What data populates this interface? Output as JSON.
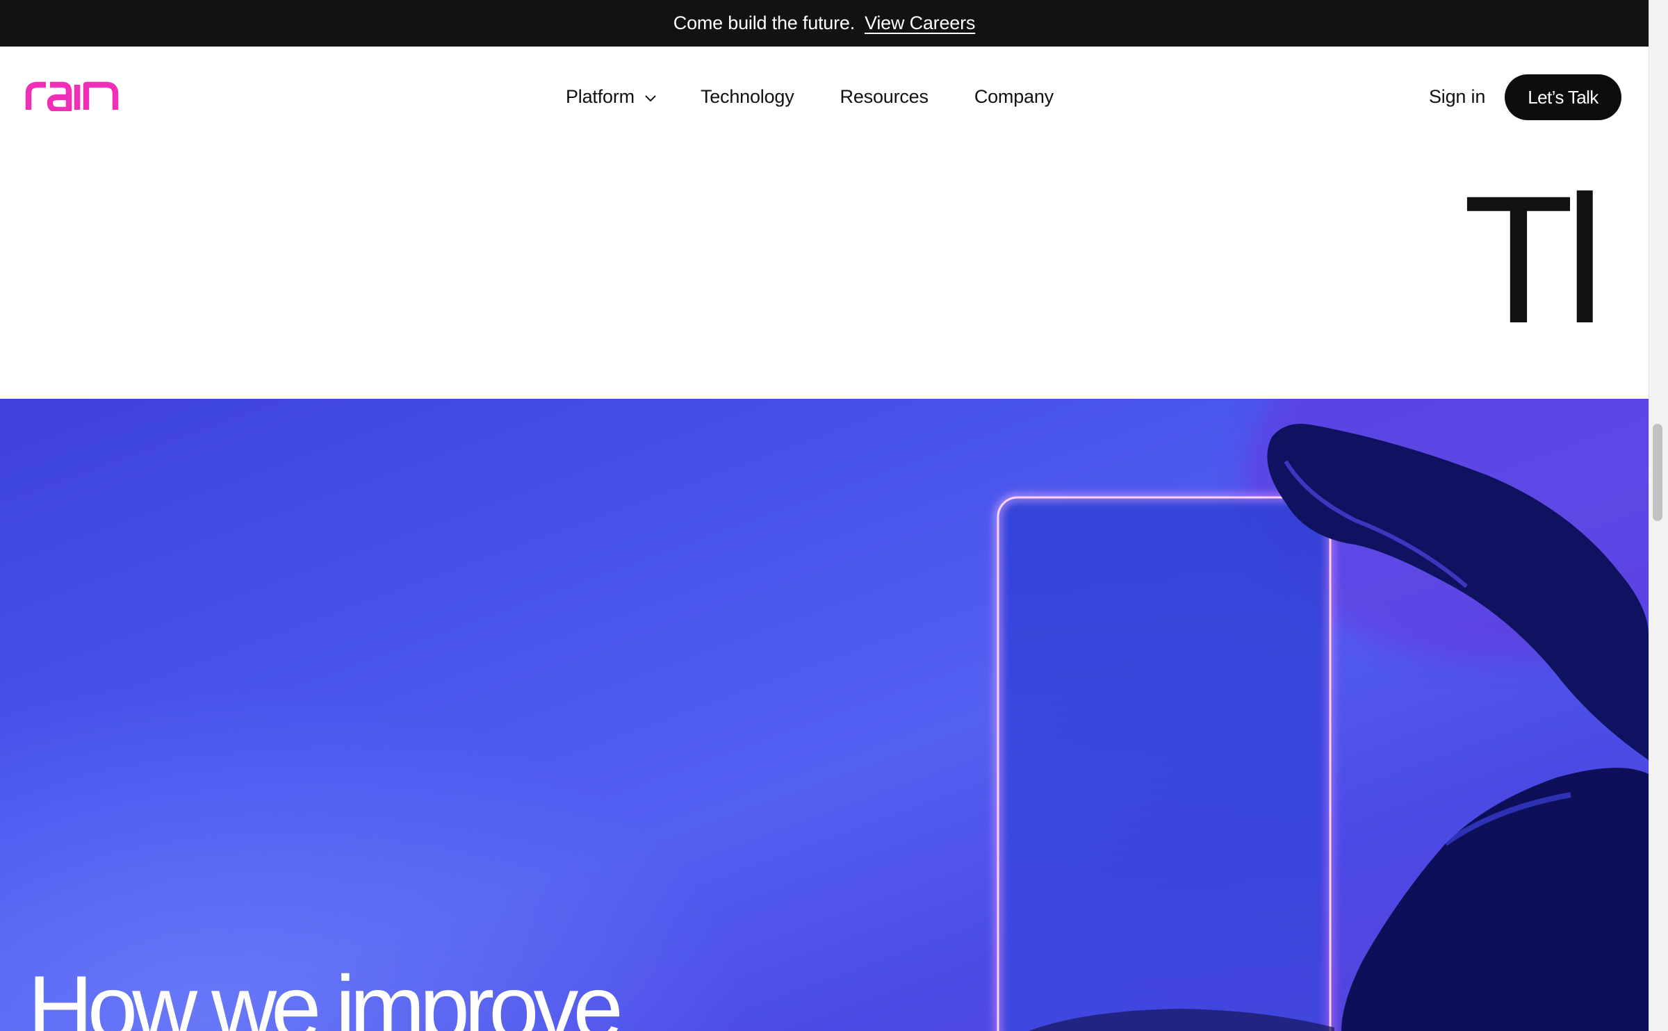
{
  "announcement": {
    "message": "Come build the future.",
    "link_label": "View Careers"
  },
  "brand": {
    "name": "rain",
    "logo_color": "#f02fb7"
  },
  "nav": {
    "items": [
      {
        "label": "Platform",
        "has_dropdown": true
      },
      {
        "label": "Technology",
        "has_dropdown": false
      },
      {
        "label": "Resources",
        "has_dropdown": false
      },
      {
        "label": "Company",
        "has_dropdown": false
      }
    ],
    "chevron_icon": "chevron-down-icon"
  },
  "header_actions": {
    "sign_in_label": "Sign in",
    "cta_label": "Let’s Talk"
  },
  "section": {
    "partial_heading": "Tl"
  },
  "hero": {
    "title": "How we improve",
    "accent_colors": [
      "#4a55ee",
      "#5a3fd6",
      "#f7a0ff"
    ]
  }
}
